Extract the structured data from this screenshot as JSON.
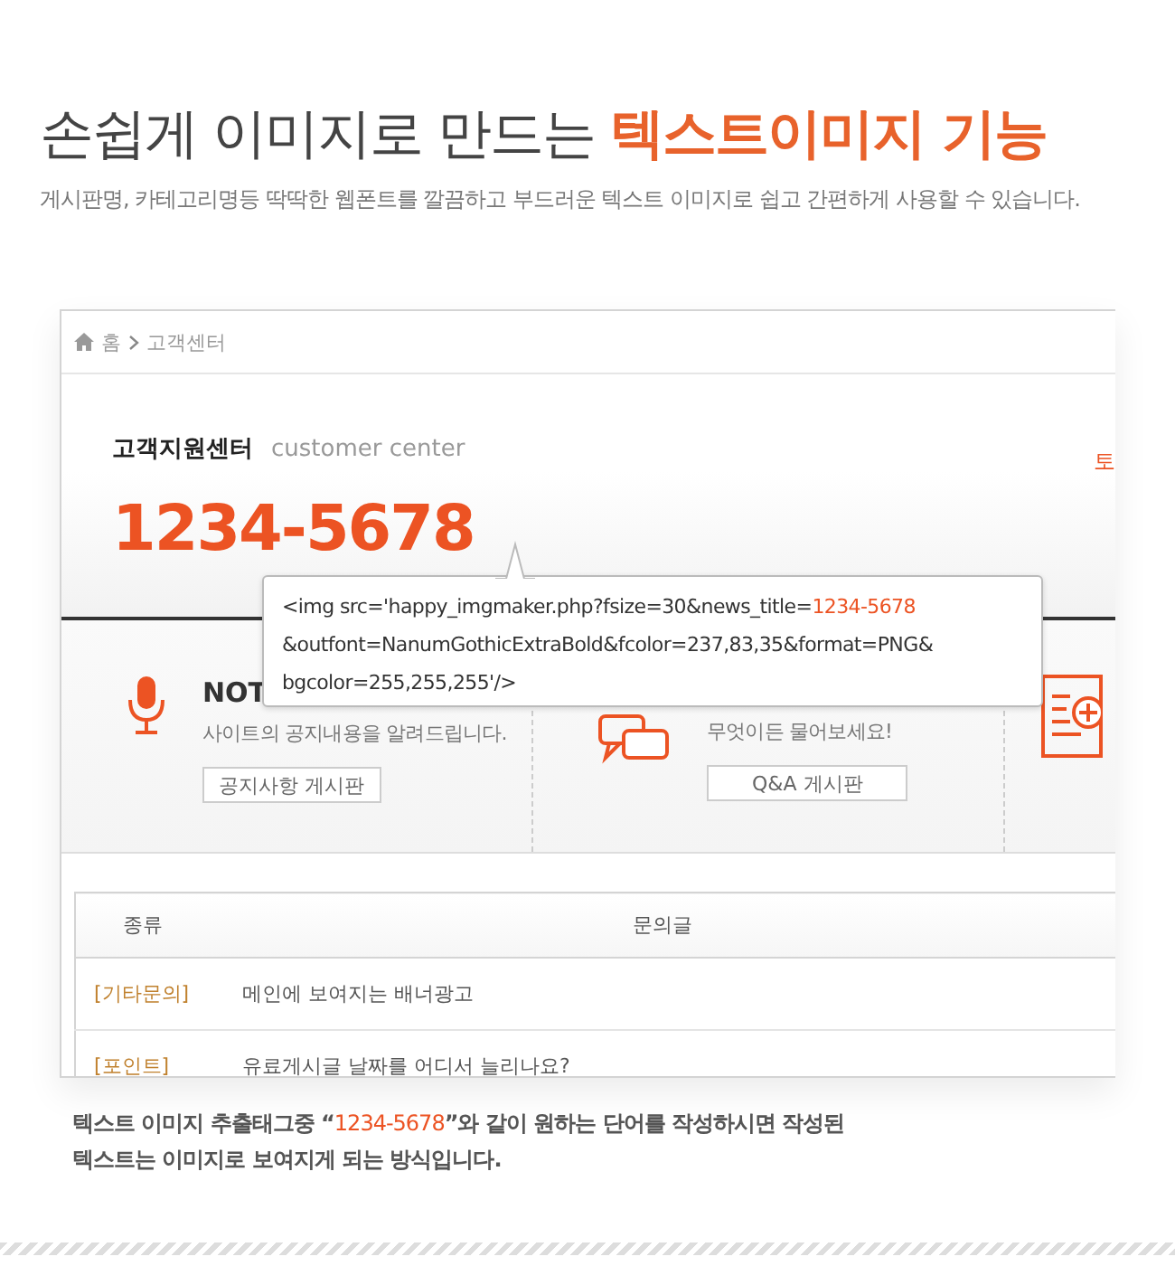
{
  "headline": {
    "plain": "손쉽게 이미지로 만드는",
    "accent": "텍스트이미지 기능"
  },
  "subtitle": "게시판명, 카테고리명등 딱딱한 웹폰트를 깔끔하고 부드러운 텍스트 이미지로 쉽고 간편하게 사용할 수 있습니다.",
  "screenshot": {
    "breadcrumb": [
      {
        "label": "홈"
      },
      {
        "label": "고객센터"
      }
    ],
    "center": {
      "title": "고객지원센터",
      "subtitle": "customer center",
      "phone": "1234-5678",
      "side_text": "토"
    },
    "tooltip": {
      "lines": [
        [
          {
            "text": "<img src='happy_imgmaker.php?fsize=30&news_title=",
            "highlight": false
          },
          {
            "text": "1234-5678",
            "highlight": true
          }
        ],
        [
          {
            "text": "&outfont=NanumGothicExtraBold&fcolor=237,83,35&format=PNG&",
            "highlight": false
          }
        ],
        [
          {
            "text": "bgcolor=255,255,255'/>",
            "highlight": false
          }
        ]
      ]
    },
    "boards": [
      {
        "kind": "notice",
        "title": "NOT",
        "description": "사이트의 공지내용을 알려드립니다.",
        "button": "공지사항 게시판"
      },
      {
        "kind": "qna",
        "description": "무엇이든 물어보세요!",
        "button": "Q&A 게시판"
      },
      {
        "kind": "request"
      }
    ],
    "table": {
      "columns": [
        "종류",
        "문의글"
      ],
      "rows": [
        {
          "category": "[기타문의]",
          "question": "메인에 보여지는 배너광고"
        },
        {
          "category": "[포인트]",
          "question": "유료게시글 날짜를 어디서 늘리나요?"
        }
      ]
    }
  },
  "footnote": {
    "lines": [
      [
        {
          "text": "텍스트 이미지 추출태그중 “",
          "highlight": false
        },
        {
          "text": "1234-5678",
          "highlight": true
        },
        {
          "text": "”와 같이 원하는 단어를 작성하시면 작성된",
          "highlight": false
        }
      ],
      [
        {
          "text": "텍스트는 이미지로 보여지게 되는 방식입니다.",
          "highlight": false
        }
      ]
    ]
  }
}
